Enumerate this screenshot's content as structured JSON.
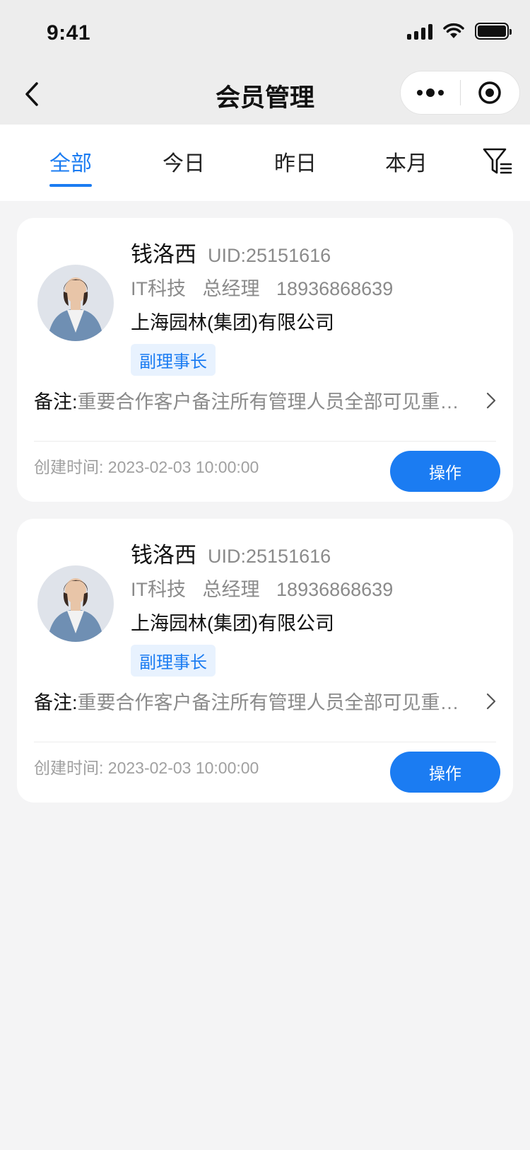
{
  "status_bar": {
    "time": "9:41"
  },
  "nav": {
    "title": "会员管理"
  },
  "tabs": [
    {
      "label": "全部",
      "active": true
    },
    {
      "label": "今日",
      "active": false
    },
    {
      "label": "昨日",
      "active": false
    },
    {
      "label": "本月",
      "active": false
    }
  ],
  "members": [
    {
      "name": "钱洛西",
      "uid": "UID:25151616",
      "industry": "IT科技",
      "position": "总经理",
      "phone": "18936868639",
      "company": "上海园林(集团)有限公司",
      "role_badge": "副理事长",
      "note_label": "备注:",
      "note_text": "重要合作客户备注所有管理人员全部可见重要合作客户",
      "created_label": "创建时间:",
      "created_time": "2023-02-03 10:00:00",
      "action_label": "操作"
    },
    {
      "name": "钱洛西",
      "uid": "UID:25151616",
      "industry": "IT科技",
      "position": "总经理",
      "phone": "18936868639",
      "company": "上海园林(集团)有限公司",
      "role_badge": "副理事长",
      "note_label": "备注:",
      "note_text": "重要合作客户备注所有管理人员全部可见重要合作客户",
      "created_label": "创建时间:",
      "created_time": "2023-02-03 10:00:00",
      "action_label": "操作"
    }
  ],
  "colors": {
    "accent": "#1b7cf2",
    "badge_bg": "#e8f2fe"
  }
}
